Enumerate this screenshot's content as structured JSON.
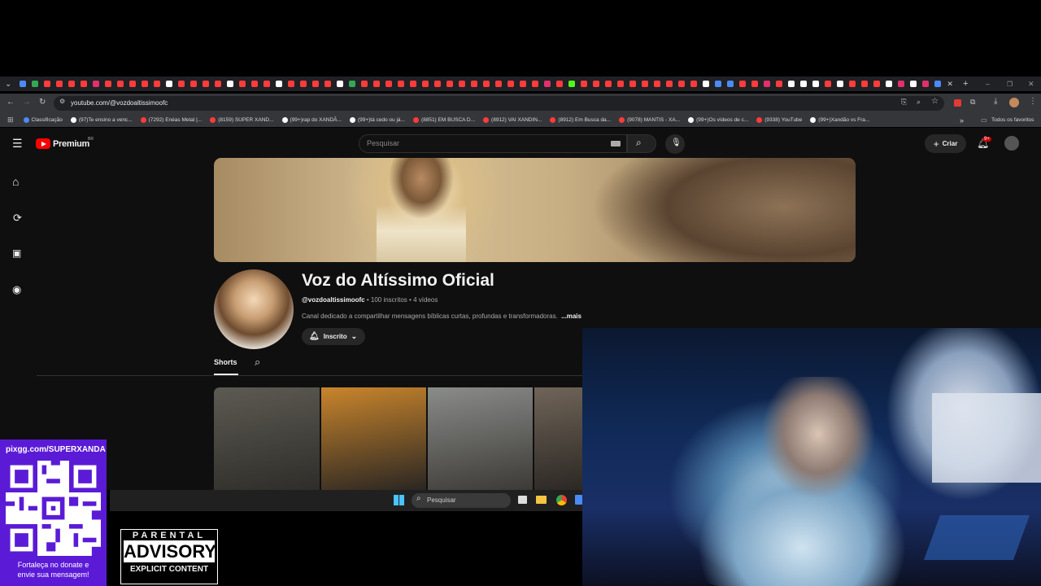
{
  "browser": {
    "url": "youtube.com/@vozdoaltissimoofc",
    "tab_colors": [
      "#4c8bf5",
      "#34a853",
      "#ff3b3b",
      "#ff3b3b",
      "#ff3b3b",
      "#ff3b3b",
      "#e1306c",
      "#ff3b3b",
      "#ff3b3b",
      "#ff3b3b",
      "#ff3b3b",
      "#ff3b3b",
      "#ffffff",
      "#ff3b3b",
      "#ff3b3b",
      "#ff3b3b",
      "#ff3b3b",
      "#ffffff",
      "#ff3b3b",
      "#ff3b3b",
      "#ff3b3b",
      "#ffffff",
      "#ff3b3b",
      "#ff3b3b",
      "#ff3b3b",
      "#ff3b3b",
      "#ffffff",
      "#34a853",
      "#ff3b3b",
      "#ff3b3b",
      "#ff3b3b",
      "#ff3b3b",
      "#ff3b3b",
      "#ff3b3b",
      "#ff3b3b",
      "#ff3b3b",
      "#ff3b3b",
      "#ff3b3b",
      "#ff3b3b",
      "#ff3b3b",
      "#ff3b3b",
      "#ff3b3b",
      "#ff3b3b",
      "#e1306c",
      "#ff3b3b",
      "#53fc18",
      "#ff3b3b",
      "#ff3b3b",
      "#ff3b3b",
      "#ff3b3b",
      "#ff3b3b",
      "#ff3b3b",
      "#ff3b3b",
      "#ff3b3b",
      "#ff3b3b",
      "#ff3b3b",
      "#ffffff",
      "#4c8bf5",
      "#4c8bf5",
      "#ff3b3b",
      "#ff3b3b",
      "#e1306c",
      "#ff3b3b",
      "#ffffff",
      "#ffffff",
      "#ffffff",
      "#ff3b3b",
      "#ffffff",
      "#ff3b3b",
      "#ff3b3b",
      "#ff3b3b",
      "#ffffff",
      "#e1306c",
      "#ffffff",
      "#e1306c",
      "#4c8bf5"
    ],
    "bookmarks": [
      {
        "label": "Classificação",
        "color": "#4c8bf5"
      },
      {
        "label": "(97)Te ensino a venc...",
        "color": "#ffffff"
      },
      {
        "label": "(7292) Enéas Metal |...",
        "color": "#ff3b3b"
      },
      {
        "label": "(8159) SUPER XAND...",
        "color": "#ff3b3b"
      },
      {
        "label": "(99+)rap do XANDÃ...",
        "color": "#ffffff"
      },
      {
        "label": "(99+)tá cedo ou já...",
        "color": "#ffffff"
      },
      {
        "label": "(8851) EM BUSCA D...",
        "color": "#ff3b3b"
      },
      {
        "label": "(8912) VAI XANDIN...",
        "color": "#ff3b3b"
      },
      {
        "label": "(8912) Em Busca da...",
        "color": "#ff3b3b"
      },
      {
        "label": "(9078) MANTIS - XA...",
        "color": "#ff3b3b"
      },
      {
        "label": "(99+)Os vídeos de c...",
        "color": "#ffffff"
      },
      {
        "label": "(9338) YouTube",
        "color": "#ff3b3b"
      },
      {
        "label": "(99+)Xandão vs Fra...",
        "color": "#ffffff"
      }
    ],
    "all_bookmarks": "Todos os favoritos"
  },
  "youtube": {
    "logo_text": "Premium",
    "logo_region": "BR",
    "search_placeholder": "Pesquisar",
    "create_label": "Criar",
    "notification_count": "9+",
    "channel": {
      "name": "Voz do Altíssimo Oficial",
      "handle": "@vozdoaltissimoofc",
      "subscribers": "100 inscritos",
      "videos": "4 vídeos",
      "separator": "•",
      "description": "Canal dedicado a compartilhar mensagens bíblicas curtas, profundas e transformadoras.",
      "more": "...mais",
      "subscribed_label": "Inscrito"
    },
    "tabs": [
      {
        "label": "Shorts"
      }
    ],
    "shorts_colors": [
      [
        "#5c5a52",
        "#2f2d29"
      ],
      [
        "#c9852c",
        "#2a2622"
      ],
      [
        "#8a8c8a",
        "#3c3a36"
      ],
      [
        "#6f6458",
        "#2c2824"
      ]
    ]
  },
  "taskbar": {
    "search_placeholder": "Pesquisar"
  },
  "overlay": {
    "pix_url": "pixgg.com/SUPERXANDA",
    "donate_text_1": "Fortaleça no donate e",
    "donate_text_2": "envie sua mensagem!",
    "advisory_top": "PARENTAL",
    "advisory_mid": "ADVISORY",
    "advisory_bottom": "EXPLICIT CONTENT"
  }
}
